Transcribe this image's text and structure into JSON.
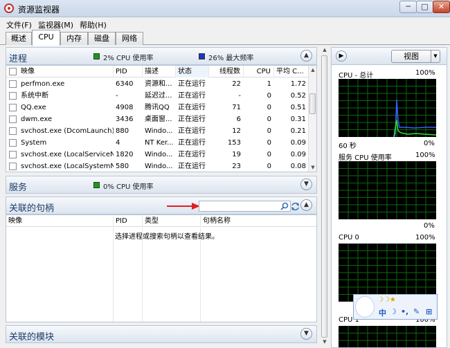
{
  "window": {
    "title": "资源监视器",
    "minimize_glyph": "─",
    "maximize_glyph": "□",
    "close_glyph": "✕"
  },
  "menu": [
    "文件(F)",
    "监视器(M)",
    "帮助(H)"
  ],
  "tabs": [
    "概述",
    "CPU",
    "内存",
    "磁盘",
    "网络"
  ],
  "active_tab": "CPU",
  "colors": {
    "cpu_usage": "#12a012",
    "max_freq": "#1c34c6",
    "graph_grid": "#0b6b0b",
    "graph_green": "#2ee02e",
    "graph_blue": "#3b5cff"
  },
  "processes": {
    "title": "进程",
    "legend_cpu": "2% CPU 使用率",
    "legend_freq": "26% 最大频率",
    "columns": [
      "映像",
      "PID",
      "描述",
      "状态",
      "线程数",
      "CPU",
      "平均 C..."
    ],
    "rows": [
      {
        "image": "perfmon.exe",
        "pid": "6340",
        "desc": "资源和...",
        "status": "正在运行",
        "threads": "22",
        "cpu": "1",
        "avg": "1.72"
      },
      {
        "image": "系统中断",
        "pid": "-",
        "desc": "延迟过...",
        "status": "正在运行",
        "threads": "-",
        "cpu": "0",
        "avg": "0.52"
      },
      {
        "image": "QQ.exe",
        "pid": "4908",
        "desc": "腾讯QQ",
        "status": "正在运行",
        "threads": "71",
        "cpu": "0",
        "avg": "0.51"
      },
      {
        "image": "dwm.exe",
        "pid": "3436",
        "desc": "桌面窗...",
        "status": "正在运行",
        "threads": "6",
        "cpu": "0",
        "avg": "0.31"
      },
      {
        "image": "svchost.exe (DcomLaunch)",
        "pid": "880",
        "desc": "Windo...",
        "status": "正在运行",
        "threads": "12",
        "cpu": "0",
        "avg": "0.21"
      },
      {
        "image": "System",
        "pid": "4",
        "desc": "NT Ker...",
        "status": "正在运行",
        "threads": "153",
        "cpu": "0",
        "avg": "0.09"
      },
      {
        "image": "svchost.exe (LocalServiceN...",
        "pid": "1820",
        "desc": "Windo...",
        "status": "正在运行",
        "threads": "19",
        "cpu": "0",
        "avg": "0.09"
      },
      {
        "image": "svchost.exe (LocalSystemN...",
        "pid": "580",
        "desc": "Windo...",
        "status": "正在运行",
        "threads": "23",
        "cpu": "0",
        "avg": "0.08"
      }
    ]
  },
  "services": {
    "title": "服务",
    "legend_cpu": "0% CPU 使用率"
  },
  "handles": {
    "title": "关联的句柄",
    "search_value": "",
    "columns": [
      "映像",
      "PID",
      "类型",
      "句柄名称"
    ],
    "empty_message": "选择进程或搜索句柄以查看结果。"
  },
  "modules": {
    "title": "关联的模块"
  },
  "right_panel": {
    "view_label": "视图",
    "graphs": [
      {
        "title": "CPU - 总计",
        "max": "100%",
        "time": "60 秒",
        "min": "0%"
      },
      {
        "title": "服务 CPU 使用率",
        "max": "100%",
        "min": "0%"
      },
      {
        "title": "CPU 0",
        "max": "100%"
      },
      {
        "title": "CPU 1",
        "max": "100%"
      }
    ]
  },
  "ime": {
    "mode": "中",
    "items": [
      "中",
      "☽",
      "•,",
      "✎",
      "⊞"
    ],
    "moons": "☽☽★"
  }
}
